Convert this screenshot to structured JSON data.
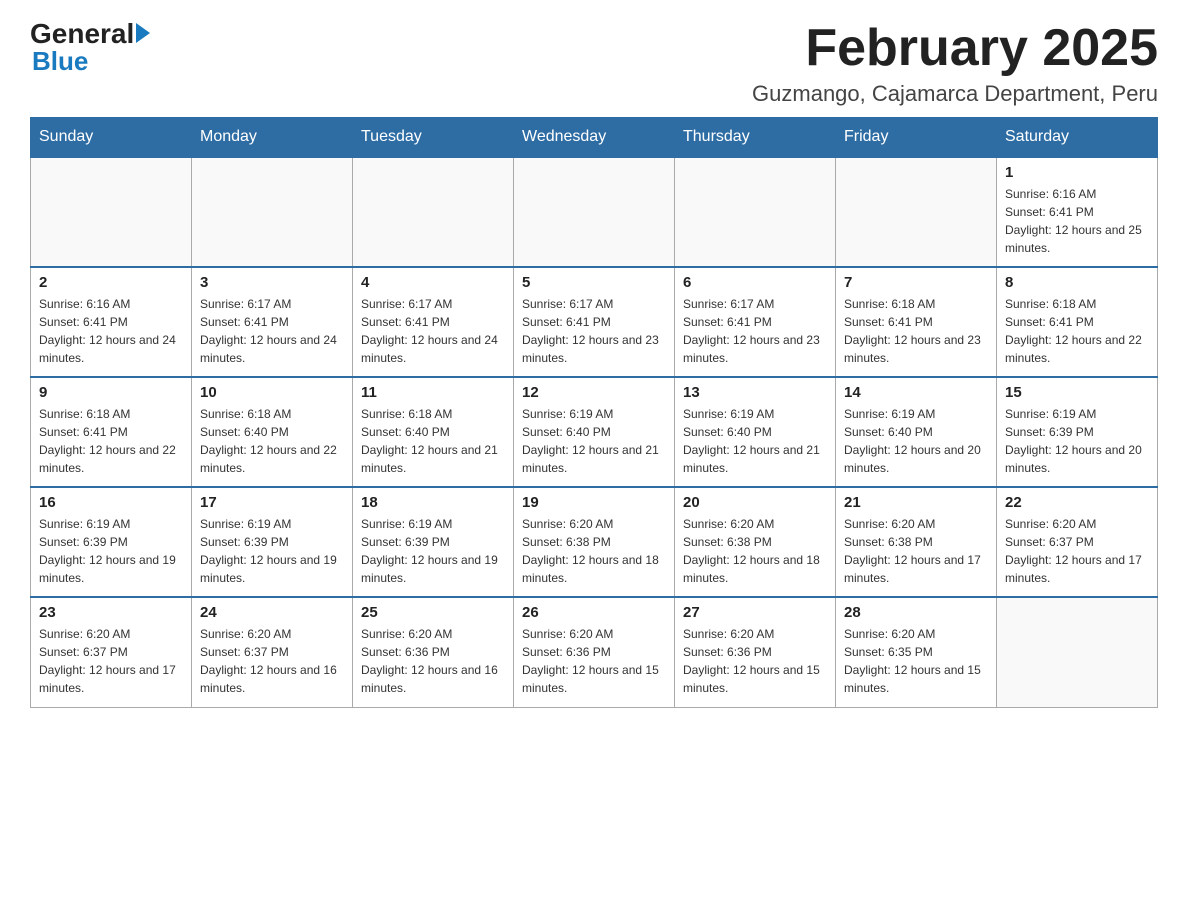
{
  "header": {
    "logo_general": "General",
    "logo_blue": "Blue",
    "month_title": "February 2025",
    "location": "Guzmango, Cajamarca Department, Peru"
  },
  "days_of_week": [
    "Sunday",
    "Monday",
    "Tuesday",
    "Wednesday",
    "Thursday",
    "Friday",
    "Saturday"
  ],
  "weeks": [
    [
      {
        "day": "",
        "info": ""
      },
      {
        "day": "",
        "info": ""
      },
      {
        "day": "",
        "info": ""
      },
      {
        "day": "",
        "info": ""
      },
      {
        "day": "",
        "info": ""
      },
      {
        "day": "",
        "info": ""
      },
      {
        "day": "1",
        "info": "Sunrise: 6:16 AM\nSunset: 6:41 PM\nDaylight: 12 hours and 25 minutes."
      }
    ],
    [
      {
        "day": "2",
        "info": "Sunrise: 6:16 AM\nSunset: 6:41 PM\nDaylight: 12 hours and 24 minutes."
      },
      {
        "day": "3",
        "info": "Sunrise: 6:17 AM\nSunset: 6:41 PM\nDaylight: 12 hours and 24 minutes."
      },
      {
        "day": "4",
        "info": "Sunrise: 6:17 AM\nSunset: 6:41 PM\nDaylight: 12 hours and 24 minutes."
      },
      {
        "day": "5",
        "info": "Sunrise: 6:17 AM\nSunset: 6:41 PM\nDaylight: 12 hours and 23 minutes."
      },
      {
        "day": "6",
        "info": "Sunrise: 6:17 AM\nSunset: 6:41 PM\nDaylight: 12 hours and 23 minutes."
      },
      {
        "day": "7",
        "info": "Sunrise: 6:18 AM\nSunset: 6:41 PM\nDaylight: 12 hours and 23 minutes."
      },
      {
        "day": "8",
        "info": "Sunrise: 6:18 AM\nSunset: 6:41 PM\nDaylight: 12 hours and 22 minutes."
      }
    ],
    [
      {
        "day": "9",
        "info": "Sunrise: 6:18 AM\nSunset: 6:41 PM\nDaylight: 12 hours and 22 minutes."
      },
      {
        "day": "10",
        "info": "Sunrise: 6:18 AM\nSunset: 6:40 PM\nDaylight: 12 hours and 22 minutes."
      },
      {
        "day": "11",
        "info": "Sunrise: 6:18 AM\nSunset: 6:40 PM\nDaylight: 12 hours and 21 minutes."
      },
      {
        "day": "12",
        "info": "Sunrise: 6:19 AM\nSunset: 6:40 PM\nDaylight: 12 hours and 21 minutes."
      },
      {
        "day": "13",
        "info": "Sunrise: 6:19 AM\nSunset: 6:40 PM\nDaylight: 12 hours and 21 minutes."
      },
      {
        "day": "14",
        "info": "Sunrise: 6:19 AM\nSunset: 6:40 PM\nDaylight: 12 hours and 20 minutes."
      },
      {
        "day": "15",
        "info": "Sunrise: 6:19 AM\nSunset: 6:39 PM\nDaylight: 12 hours and 20 minutes."
      }
    ],
    [
      {
        "day": "16",
        "info": "Sunrise: 6:19 AM\nSunset: 6:39 PM\nDaylight: 12 hours and 19 minutes."
      },
      {
        "day": "17",
        "info": "Sunrise: 6:19 AM\nSunset: 6:39 PM\nDaylight: 12 hours and 19 minutes."
      },
      {
        "day": "18",
        "info": "Sunrise: 6:19 AM\nSunset: 6:39 PM\nDaylight: 12 hours and 19 minutes."
      },
      {
        "day": "19",
        "info": "Sunrise: 6:20 AM\nSunset: 6:38 PM\nDaylight: 12 hours and 18 minutes."
      },
      {
        "day": "20",
        "info": "Sunrise: 6:20 AM\nSunset: 6:38 PM\nDaylight: 12 hours and 18 minutes."
      },
      {
        "day": "21",
        "info": "Sunrise: 6:20 AM\nSunset: 6:38 PM\nDaylight: 12 hours and 17 minutes."
      },
      {
        "day": "22",
        "info": "Sunrise: 6:20 AM\nSunset: 6:37 PM\nDaylight: 12 hours and 17 minutes."
      }
    ],
    [
      {
        "day": "23",
        "info": "Sunrise: 6:20 AM\nSunset: 6:37 PM\nDaylight: 12 hours and 17 minutes."
      },
      {
        "day": "24",
        "info": "Sunrise: 6:20 AM\nSunset: 6:37 PM\nDaylight: 12 hours and 16 minutes."
      },
      {
        "day": "25",
        "info": "Sunrise: 6:20 AM\nSunset: 6:36 PM\nDaylight: 12 hours and 16 minutes."
      },
      {
        "day": "26",
        "info": "Sunrise: 6:20 AM\nSunset: 6:36 PM\nDaylight: 12 hours and 15 minutes."
      },
      {
        "day": "27",
        "info": "Sunrise: 6:20 AM\nSunset: 6:36 PM\nDaylight: 12 hours and 15 minutes."
      },
      {
        "day": "28",
        "info": "Sunrise: 6:20 AM\nSunset: 6:35 PM\nDaylight: 12 hours and 15 minutes."
      },
      {
        "day": "",
        "info": ""
      }
    ]
  ]
}
